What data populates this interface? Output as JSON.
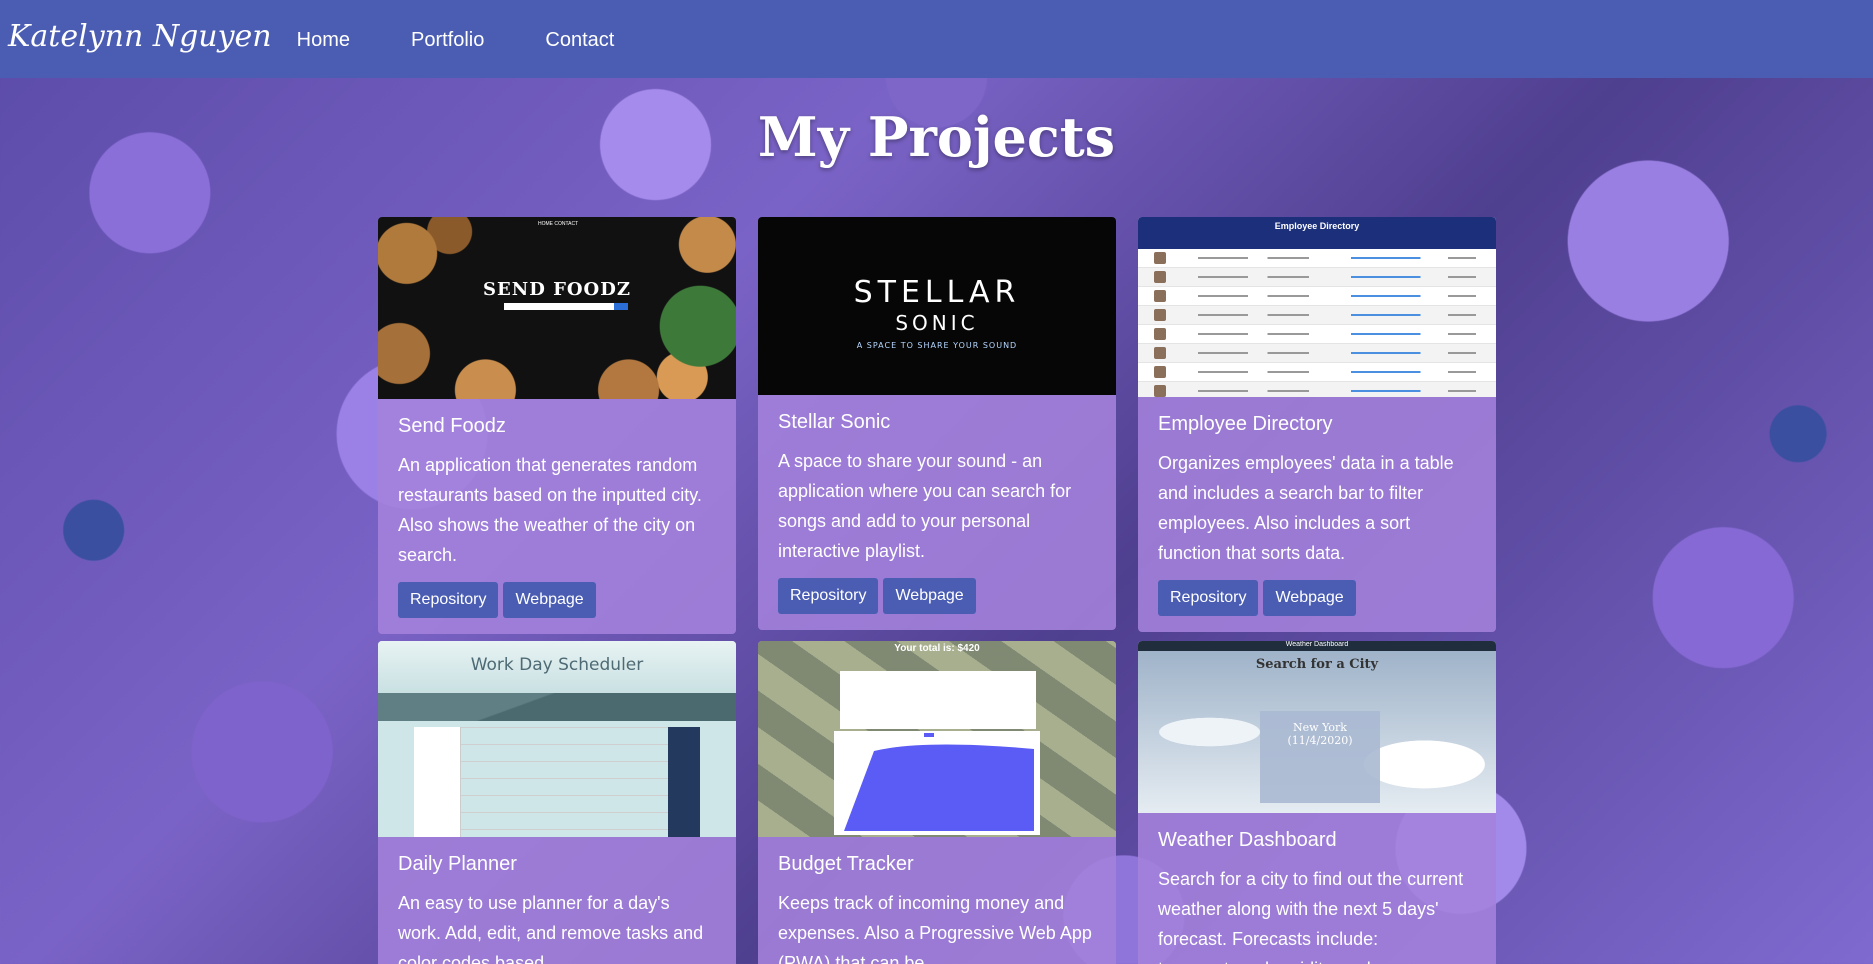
{
  "nav": {
    "brand": "Katelynn Nguyen",
    "links": [
      "Home",
      "Portfolio",
      "Contact"
    ]
  },
  "page": {
    "title": "My Projects"
  },
  "projects": [
    {
      "title": "Send Foodz",
      "description": "An application that generates random restaurants based on the inputted city. Also shows the weather of the city on search.",
      "buttons": [
        "Repository",
        "Webpage"
      ],
      "thumb_text": "SEND FOODZ",
      "thumb_menu": "HOME   CONTACT"
    },
    {
      "title": "Stellar Sonic",
      "description": "A space to share your sound - an application where you can search for songs and add to your personal interactive playlist.",
      "buttons": [
        "Repository",
        "Webpage"
      ],
      "thumb_line1": "STELLAR",
      "thumb_line2": "SONIC",
      "thumb_line3": "A SPACE TO SHARE YOUR SOUND"
    },
    {
      "title": "Employee Directory",
      "description": "Organizes employees' data in a table and includes a search bar to filter employees. Also includes a sort function that sorts data.",
      "buttons": [
        "Repository",
        "Webpage"
      ],
      "thumb_header": "Employee Directory"
    },
    {
      "title": "Daily Planner",
      "description": "An easy to use planner for a day's work. Add, edit, and remove tasks and color codes based",
      "thumb_text": "Work Day Scheduler"
    },
    {
      "title": "Budget Tracker",
      "description": "Keeps track of incoming money and expenses. Also a Progressive Web App (PWA) that can be",
      "thumb_text": "Your total is: $420"
    },
    {
      "title": "Weather Dashboard",
      "description": "Search for a city to find out the current weather along with the next 5 days' forecast. Forecasts include: temperature, humidity, and",
      "thumb_top": "Weather Dashboard",
      "thumb_text": "Search for a City",
      "thumb_city": "New York (11/4/2020)"
    }
  ]
}
